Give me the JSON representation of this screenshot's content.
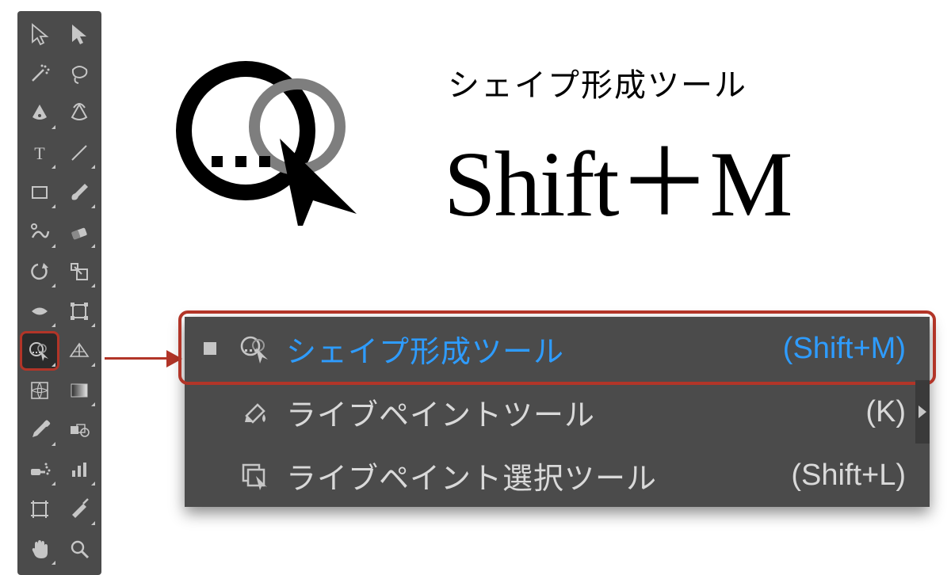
{
  "hero": {
    "subtitle": "シェイプ形成ツール",
    "shortcut": "Shift＋M"
  },
  "toolbar": {
    "tools": [
      {
        "name": "selection-tool"
      },
      {
        "name": "direct-selection-tool"
      },
      {
        "name": "magic-wand-tool"
      },
      {
        "name": "lasso-tool"
      },
      {
        "name": "pen-tool"
      },
      {
        "name": "curvature-tool"
      },
      {
        "name": "type-tool"
      },
      {
        "name": "line-tool"
      },
      {
        "name": "rectangle-tool"
      },
      {
        "name": "paintbrush-tool"
      },
      {
        "name": "shaper-tool"
      },
      {
        "name": "eraser-tool"
      },
      {
        "name": "rotate-tool"
      },
      {
        "name": "scale-tool"
      },
      {
        "name": "width-tool"
      },
      {
        "name": "free-transform-tool"
      },
      {
        "name": "shape-builder-tool",
        "selected": true
      },
      {
        "name": "perspective-grid-tool"
      },
      {
        "name": "mesh-tool"
      },
      {
        "name": "gradient-tool"
      },
      {
        "name": "eyedropper-tool"
      },
      {
        "name": "blend-tool"
      },
      {
        "name": "symbol-sprayer-tool"
      },
      {
        "name": "column-graph-tool"
      },
      {
        "name": "artboard-tool"
      },
      {
        "name": "slice-tool"
      },
      {
        "name": "hand-tool"
      },
      {
        "name": "zoom-tool"
      }
    ]
  },
  "flyout": {
    "items": [
      {
        "label": "シェイプ形成ツール",
        "shortcut": "(Shift+M)",
        "active": true
      },
      {
        "label": "ライブペイントツール",
        "shortcut": "(K)"
      },
      {
        "label": "ライブペイント選択ツール",
        "shortcut": "(Shift+L)"
      }
    ]
  }
}
